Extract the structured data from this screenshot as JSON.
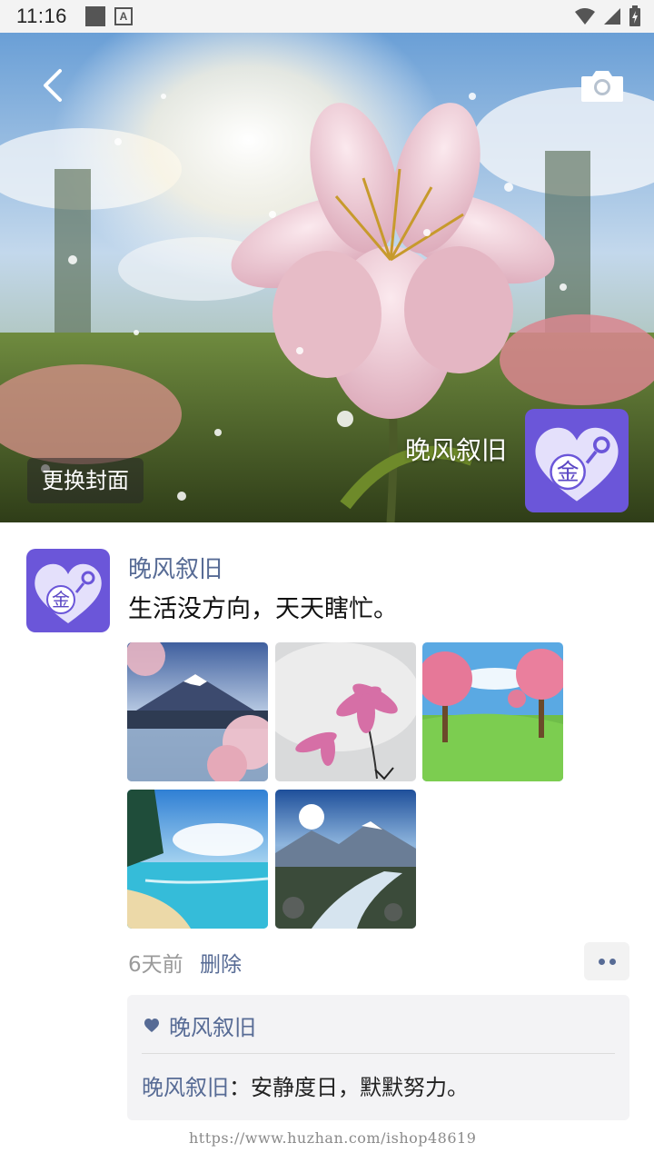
{
  "status_bar": {
    "time": "11:16",
    "keyboard_badge": "A"
  },
  "cover": {
    "user_name": "晚风叙旧",
    "change_cover_label": "更换封面",
    "avatar_glyph": "金",
    "back_icon": "chevron-left-icon",
    "camera_icon": "camera-icon"
  },
  "post": {
    "user_name": "晚风叙旧",
    "text": "生活没方向，天天瞎忙。",
    "avatar_glyph": "金",
    "photos": [
      "mountain-lake-cherry-blossom",
      "pink-flowers-mist",
      "pink-trees-meadow",
      "tropical-beach",
      "mountain-stream"
    ],
    "time": "6天前",
    "delete_label": "删除",
    "likes": {
      "names": "晚风叙旧",
      "icon": "heart-icon"
    },
    "comments": [
      {
        "author": "晚风叙旧",
        "separator": "：",
        "text": "安静度日，默默努力。"
      }
    ]
  },
  "watermark": "https://www.huzhan.com/ishop48619",
  "colors": {
    "link": "#576b95",
    "avatar_bg": "#6b56d9",
    "status_bar_bg": "#f3f3f3"
  }
}
